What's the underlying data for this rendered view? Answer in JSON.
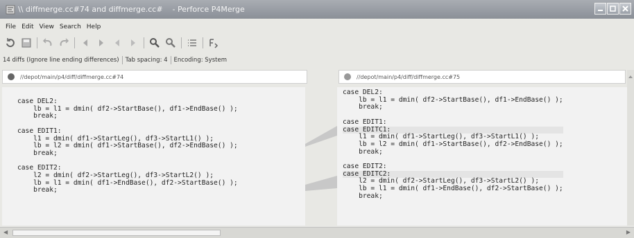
{
  "window": {
    "title": "\\\\ diffmerge.cc#74 and diffmerge.cc#    - Perforce P4Merge"
  },
  "menu": [
    "File",
    "Edit",
    "View",
    "Search",
    "Help"
  ],
  "infobar": {
    "diffs": "14 diffs (Ignore line ending differences)",
    "tabs": "Tab spacing: 4",
    "encoding": "Encoding: System"
  },
  "left_pane": {
    "path": "//depot/main/p4/diff/diffmerge.cc#74",
    "lines": [
      "case DEL2:",
      "    lb = l1 = dmin( df2->StartBase(), df1->EndBase() );",
      "    break;",
      "",
      "case EDIT1:",
      "    l1 = dmin( df1->StartLeg(), df3->StartL1() );",
      "    lb = l2 = dmin( df1->StartBase(), df2->EndBase() );",
      "    break;",
      "",
      "case EDIT2:",
      "    l2 = dmin( df2->StartLeg(), df3->StartL2() );",
      "    lb = l1 = dmin( df1->EndBase(), df2->StartBase() );",
      "    break;"
    ]
  },
  "right_pane": {
    "path": "//depot/main/p4/diff/diffmerge.cc#75",
    "lines": [
      "case DEL2:",
      "    lb = l1 = dmin( df2->StartBase(), df1->EndBase() );",
      "    break;",
      "",
      "case EDIT1:",
      "case EDITC1:",
      "    l1 = dmin( df1->StartLeg(), df3->StartL1() );",
      "    lb = l2 = dmin( df1->StartBase(), df2->EndBase() );",
      "    break;",
      "",
      "case EDIT2:",
      "case EDITC2:",
      "    l2 = dmin( df2->StartLeg(), df3->StartL2() );",
      "    lb = l1 = dmin( df1->EndBase(), df2->StartBase() );",
      "    break;"
    ],
    "highlighted": [
      5,
      11
    ]
  }
}
